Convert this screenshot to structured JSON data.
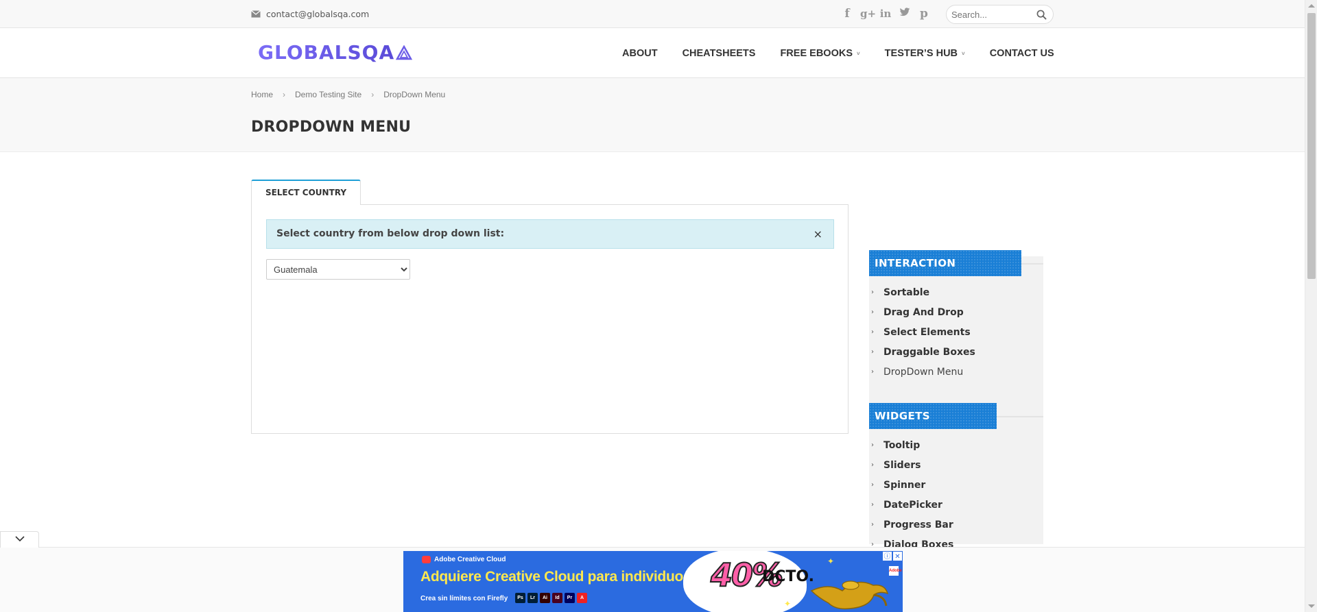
{
  "topbar": {
    "email": "contact@globalsqa.com",
    "search_placeholder": "Search...",
    "social_icons": [
      "facebook-icon",
      "google-plus-icon",
      "linkedin-icon",
      "twitter-icon",
      "pinterest-icon"
    ]
  },
  "header": {
    "logo": "GLOBALSQA",
    "nav": [
      {
        "label": "ABOUT",
        "has_dropdown": false
      },
      {
        "label": "CHEATSHEETS",
        "has_dropdown": false
      },
      {
        "label": "FREE EBOOKS",
        "has_dropdown": true
      },
      {
        "label": "TESTER’S HUB",
        "has_dropdown": true
      },
      {
        "label": "CONTACT US",
        "has_dropdown": false
      }
    ]
  },
  "breadcrumb": [
    "Home",
    "Demo Testing Site",
    "DropDown Menu"
  ],
  "page_title": "DROPDOWN MENU",
  "main": {
    "tab_label": "SELECT COUNTRY",
    "alert_text": "Select country from below drop down list:",
    "alert_close": "×",
    "select_value": "Guatemala"
  },
  "sidebar": {
    "interaction": {
      "title": "INTERACTION",
      "items": [
        "Sortable",
        "Drag And Drop",
        "Select Elements",
        "Draggable Boxes",
        "DropDown Menu"
      ],
      "current": "DropDown Menu"
    },
    "widgets": {
      "title": "WIDGETS",
      "items": [
        "Tooltip",
        "Sliders",
        "Spinner",
        "DatePicker",
        "Progress Bar",
        "Dialog Boxes"
      ]
    }
  },
  "ad": {
    "brand": "Adobe Creative Cloud",
    "headline": "Adquiere Creative Cloud para individuos con",
    "sub": "Crea sin límites con Firefly",
    "percent": "40%",
    "discount": "DCTO.",
    "apps": [
      {
        "label": "Ps",
        "color": "#001e36"
      },
      {
        "label": "Lr",
        "color": "#001e36"
      },
      {
        "label": "Ai",
        "color": "#330000"
      },
      {
        "label": "Id",
        "color": "#49021f"
      },
      {
        "label": "Pr",
        "color": "#00005b"
      },
      {
        "label": "A",
        "color": "#e22"
      }
    ],
    "adobe_mark": "Adobe"
  },
  "colors": {
    "accent_blue": "#1a7fd6",
    "tab_border": "#1e9fd6",
    "logo_purple": "#6c5ce7",
    "alert_bg": "#d9f0f5"
  }
}
